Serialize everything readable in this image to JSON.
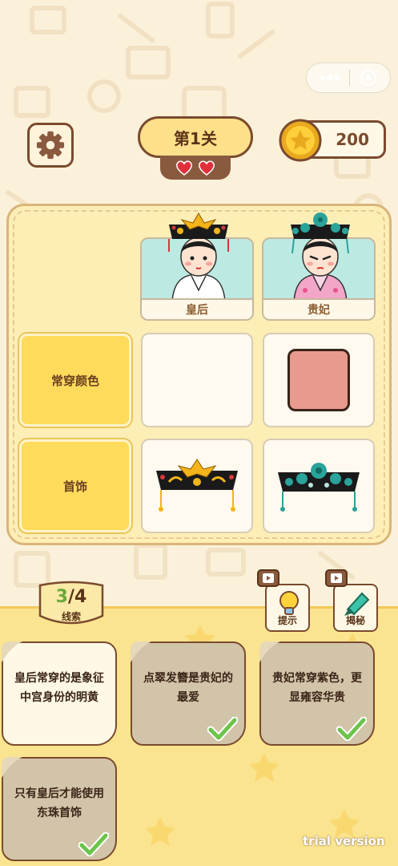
{
  "header": {
    "level_label": "第1关",
    "lives": 2,
    "coins": "200"
  },
  "board": {
    "columns": [
      {
        "name": "皇后",
        "portrait": "empress-portrait-icon"
      },
      {
        "name": "贵妃",
        "portrait": "consort-portrait-icon"
      }
    ],
    "rows": [
      {
        "label": "常穿颜色",
        "cells": [
          "",
          "color-swatch"
        ]
      },
      {
        "label": "首饰",
        "cells": [
          "phoenix-headdress-icon",
          "jade-flower-headdress-icon"
        ]
      }
    ],
    "swatch_color": "#e89a8e"
  },
  "clues": {
    "current": "3",
    "separator": "/",
    "total": "4",
    "label": "线索",
    "items": [
      {
        "text": "皇后常穿的是象征中宫身份的明黄",
        "done": false
      },
      {
        "text": "点翠发簪是贵妃的最爱",
        "done": true
      },
      {
        "text": "贵妃常穿紫色，更显雍容华贵",
        "done": true
      },
      {
        "text": "只有皇后才能使用东珠首饰",
        "done": true
      }
    ]
  },
  "tools": {
    "hint_label": "提示",
    "reveal_label": "揭秘"
  },
  "watermark": "trial version",
  "colors": {
    "accent_brown": "#7a4a2e",
    "label_yellow": "#ffdb5c",
    "check_green": "#6cc44a"
  }
}
